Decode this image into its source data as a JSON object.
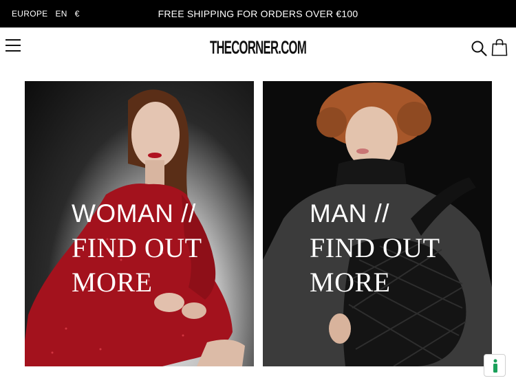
{
  "topbar": {
    "region": "EUROPE",
    "language": "EN",
    "currency": "€",
    "promo": "FREE SHIPPING FOR ORDERS OVER €100"
  },
  "header": {
    "logo": "THECORNER.COM"
  },
  "tiles": [
    {
      "line1": "WOMAN //",
      "line2": "FIND OUT",
      "line3": "MORE"
    },
    {
      "line1": "MAN //",
      "line2": "FIND OUT",
      "line3": "MORE"
    }
  ],
  "colors": {
    "topbar_bg": "#000000",
    "help_icon": "#1aa05a",
    "dress_red": "#a3121d"
  },
  "icons": [
    "menu-icon",
    "search-icon",
    "shopping-bag-icon",
    "help-icon"
  ]
}
